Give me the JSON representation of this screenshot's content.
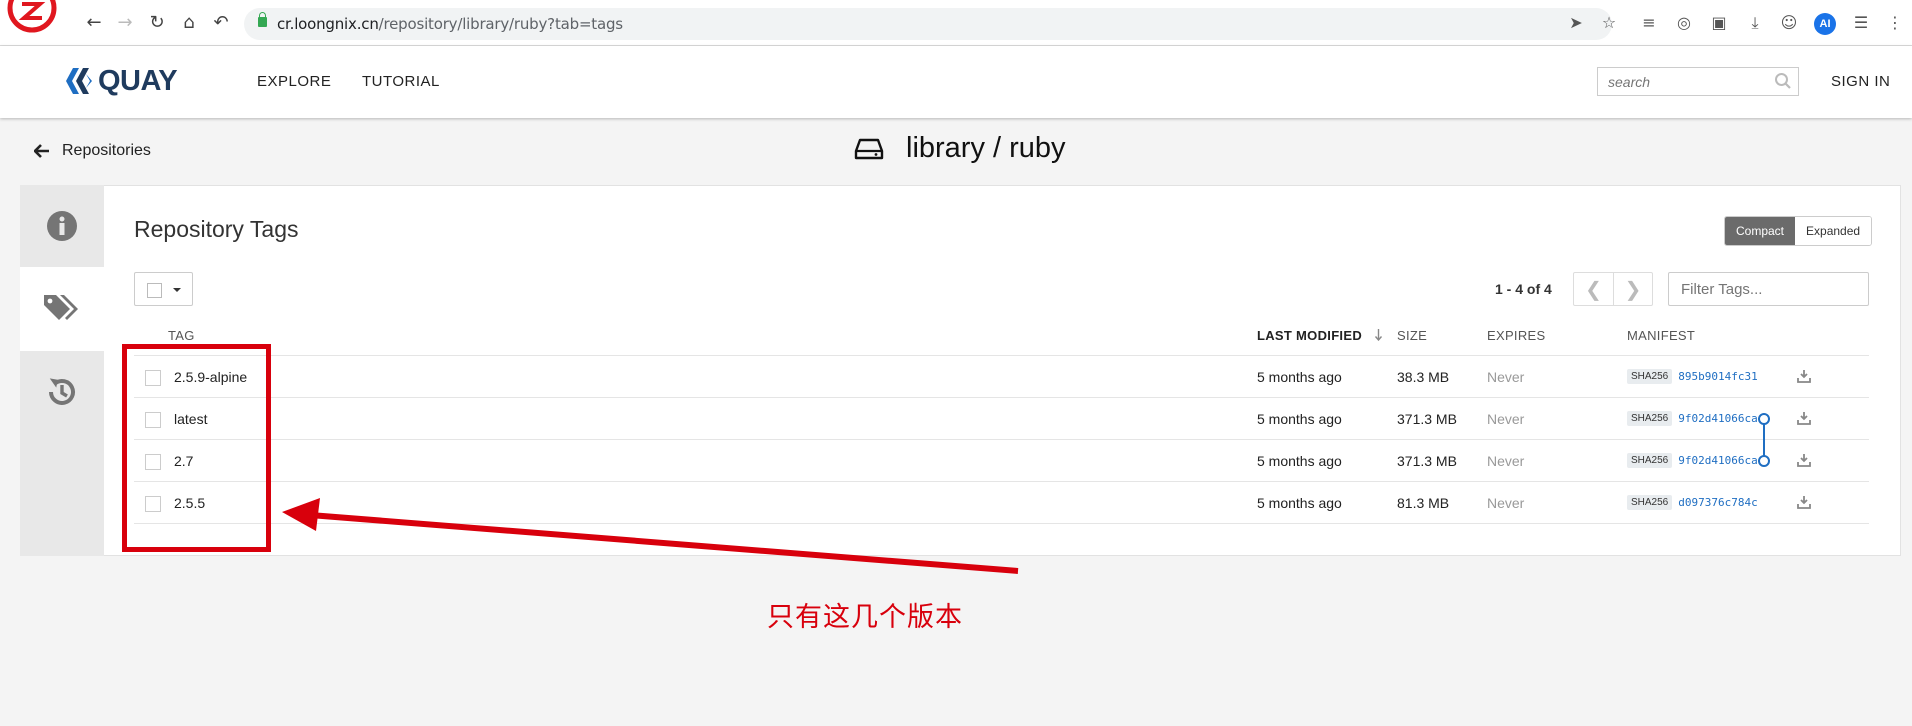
{
  "browser": {
    "url_host": "cr.loongnix.cn",
    "url_path": "/repository/library/ruby?tab=tags",
    "ai_label": "AI"
  },
  "header": {
    "logo_text": "QUAY",
    "nav": [
      "EXPLORE",
      "TUTORIAL"
    ],
    "search_placeholder": "search",
    "sign_in": "SIGN IN"
  },
  "breadcrumb": {
    "back_label": "Repositories",
    "repo_title": "library / ruby"
  },
  "tags_panel": {
    "title": "Repository Tags",
    "view_modes": [
      "Compact",
      "Expanded"
    ],
    "active_view": "Compact",
    "paging": "1 - 4 of 4",
    "pager_prev": "❮",
    "pager_next": "❯",
    "filter_placeholder": "Filter Tags...",
    "columns": {
      "tag": "TAG",
      "last_modified": "LAST MODIFIED",
      "size": "SIZE",
      "expires": "EXPIRES",
      "manifest": "MANIFEST"
    },
    "rows": [
      {
        "tag": "2.5.9-alpine",
        "modified": "5 months ago",
        "size": "38.3 MB",
        "expires": "Never",
        "digest_label": "SHA256",
        "digest": "895b9014fc31"
      },
      {
        "tag": "latest",
        "modified": "5 months ago",
        "size": "371.3 MB",
        "expires": "Never",
        "digest_label": "SHA256",
        "digest": "9f02d41066ca"
      },
      {
        "tag": "2.7",
        "modified": "5 months ago",
        "size": "371.3 MB",
        "expires": "Never",
        "digest_label": "SHA256",
        "digest": "9f02d41066ca"
      },
      {
        "tag": "2.5.5",
        "modified": "5 months ago",
        "size": "81.3 MB",
        "expires": "Never",
        "digest_label": "SHA256",
        "digest": "d097376c784c"
      }
    ]
  },
  "annotation": {
    "note": "只有这几个版本",
    "color": "#d8000c"
  },
  "colors": {
    "brand": "#1f3b5e",
    "link": "#1f6ec2",
    "active_toggle": "#6b6b6b"
  }
}
